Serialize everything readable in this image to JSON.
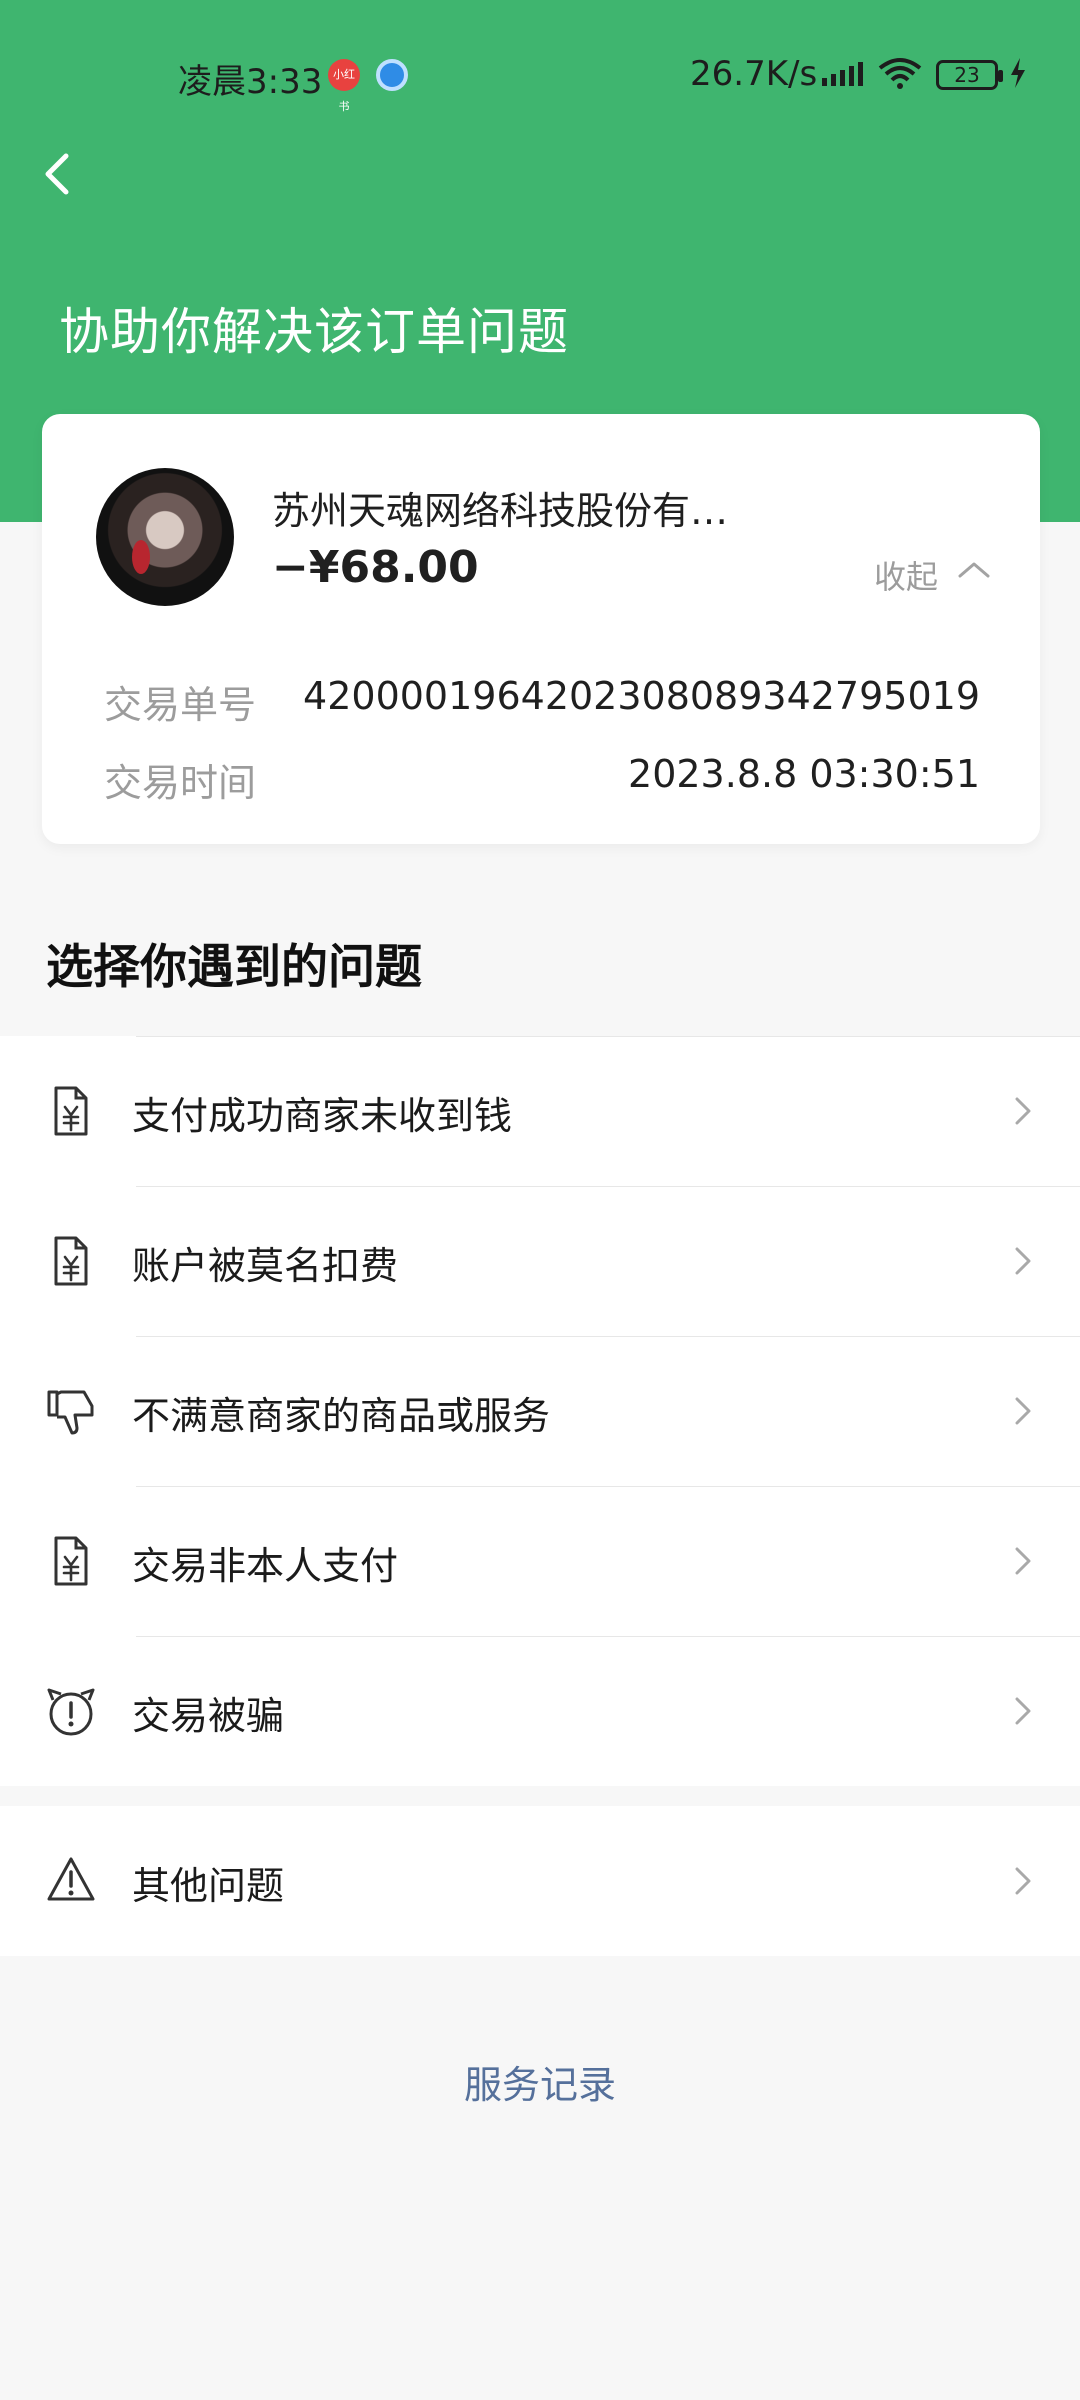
{
  "status_bar": {
    "time": "凌晨3:33",
    "badge_red": "小红书",
    "speed": "26.7K/s",
    "battery": "23"
  },
  "header": {
    "title": "协助你解决该订单问题"
  },
  "order": {
    "merchant": "苏州天魂网络科技股份有…",
    "amount": "−¥68.00",
    "collapse_label": "收起",
    "details": [
      {
        "label": "交易单号",
        "value": "4200001964202308089342795019"
      },
      {
        "label": "交易时间",
        "value": "2023.8.8 03:30:51"
      }
    ]
  },
  "section_title": "选择你遇到的问题",
  "problems": [
    {
      "label": "支付成功商家未收到钱",
      "icon": "receipt-yuan-icon"
    },
    {
      "label": "账户被莫名扣费",
      "icon": "receipt-yuan-icon"
    },
    {
      "label": "不满意商家的商品或服务",
      "icon": "thumbs-down-icon"
    },
    {
      "label": "交易非本人支付",
      "icon": "receipt-yuan-icon"
    },
    {
      "label": "交易被骗",
      "icon": "alarm-warning-icon"
    }
  ],
  "other": {
    "label": "其他问题",
    "icon": "warning-triangle-icon"
  },
  "footer": {
    "service_record": "服务记录"
  },
  "colors": {
    "header_green": "#3fb56f",
    "link_blue": "#55709b",
    "muted_gray": "#9c9c9c"
  }
}
